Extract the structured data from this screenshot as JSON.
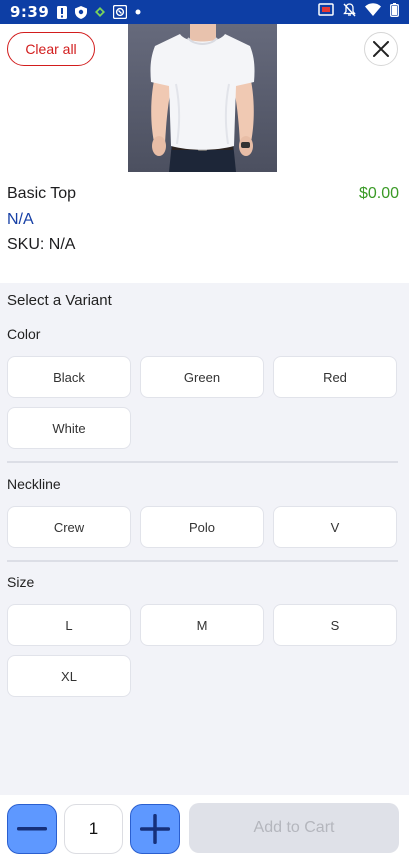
{
  "status_bar": {
    "time": "9:39",
    "icons_left": [
      "alert-icon",
      "shield-icon",
      "vpn-icon",
      "app-icon",
      "dot-icon"
    ],
    "icons_right": [
      "cast-icon",
      "mute-icon",
      "wifi-icon",
      "battery-icon"
    ]
  },
  "product": {
    "clear_label": "Clear all",
    "name": "Basic Top",
    "price": "$0.00",
    "subtitle": "N/A",
    "sku": "SKU: N/A",
    "price_color": "#3a9a26",
    "subtitle_color": "#1740a6"
  },
  "variants": {
    "title": "Select a Variant",
    "groups": [
      {
        "label": "Color",
        "options": [
          "Black",
          "Green",
          "Red",
          "White"
        ]
      },
      {
        "label": "Neckline",
        "options": [
          "Crew",
          "Polo",
          "V"
        ]
      },
      {
        "label": "Size",
        "options": [
          "L",
          "M",
          "S",
          "XL"
        ]
      }
    ]
  },
  "cart": {
    "quantity": "1",
    "add_label": "Add to Cart",
    "accent_color": "#5e98ff"
  }
}
